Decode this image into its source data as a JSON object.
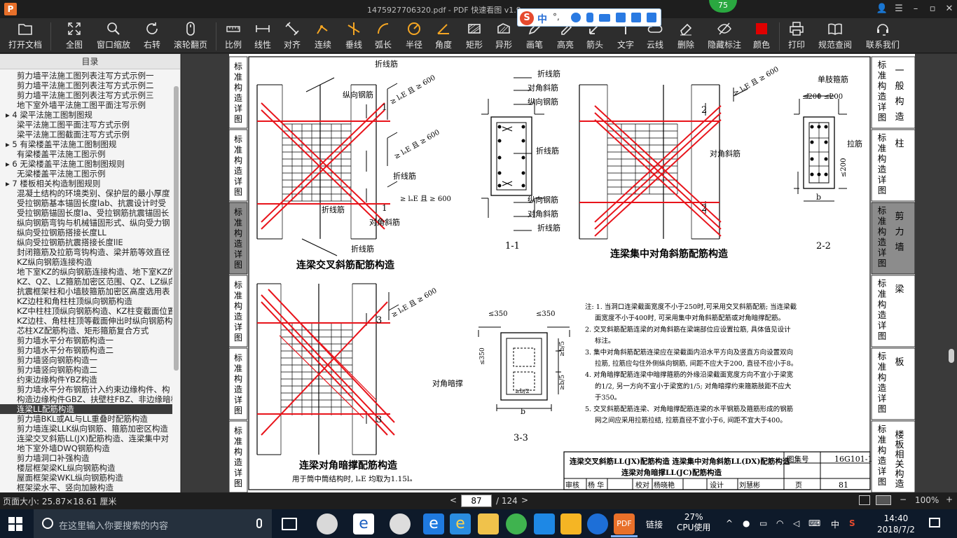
{
  "titlebar": {
    "title": "1475927706320.pdf - PDF 快速看图 v1.9",
    "logo": "P",
    "score": "75",
    "ime_zh": "中",
    "ime_symbols": "°,",
    "controls": [
      "user-icon",
      "menu-icon",
      "minimize-icon",
      "maximize-icon",
      "close-icon"
    ]
  },
  "toolbar": {
    "items": [
      {
        "label": "打开文档",
        "icon": "folder-icon"
      },
      {
        "label": "全图",
        "icon": "fit-icon"
      },
      {
        "label": "窗口缩放",
        "icon": "magnifier-icon"
      },
      {
        "label": "右转",
        "icon": "rotate-icon"
      },
      {
        "label": "滚轮翻页",
        "icon": "mouse-icon"
      },
      {
        "label": "比例",
        "icon": "ruler-icon"
      },
      {
        "label": "线性",
        "icon": "linear-icon"
      },
      {
        "label": "对齐",
        "icon": "align-icon"
      },
      {
        "label": "连续",
        "icon": "continuous-icon"
      },
      {
        "label": "垂线",
        "icon": "perpendicular-icon"
      },
      {
        "label": "弧长",
        "icon": "arc-icon"
      },
      {
        "label": "半径",
        "icon": "radius-icon"
      },
      {
        "label": "角度",
        "icon": "angle-icon"
      },
      {
        "label": "矩形",
        "icon": "rectangle-icon"
      },
      {
        "label": "异形",
        "icon": "polygon-icon"
      },
      {
        "label": "画笔",
        "icon": "pen-icon"
      },
      {
        "label": "高亮",
        "icon": "highlight-icon"
      },
      {
        "label": "箭头",
        "icon": "arrow-icon"
      },
      {
        "label": "文字",
        "icon": "text-icon"
      },
      {
        "label": "云线",
        "icon": "cloud-icon"
      },
      {
        "label": "删除",
        "icon": "eraser-icon"
      },
      {
        "label": "隐藏标注",
        "icon": "eye-icon"
      },
      {
        "label": "颜色",
        "icon": "color-icon"
      },
      {
        "label": "打印",
        "icon": "printer-icon"
      },
      {
        "label": "规范查阅",
        "icon": "book-icon"
      },
      {
        "label": "联系我们",
        "icon": "support-icon"
      }
    ],
    "accent_color": "#e00000"
  },
  "sidebar": {
    "header": "目录",
    "items": [
      {
        "text": "剪力墙平法施工图列表注写方式示例一",
        "level": 2
      },
      {
        "text": "剪力墙平法施工图列表注写方式示例二",
        "level": 2
      },
      {
        "text": "剪力墙平法施工图列表注写方式示例三",
        "level": 2
      },
      {
        "text": "地下室外墙平法施工图平面注写示例",
        "level": 2
      },
      {
        "text": "4 梁平法施工图制图规",
        "level": 1,
        "marker": "▸"
      },
      {
        "text": "梁平法施工图平面注写方式示例",
        "level": 2
      },
      {
        "text": "梁平法施工图截面注写方式示例",
        "level": 2
      },
      {
        "text": "5 有梁楼盖平法施工图制图规",
        "level": 1,
        "marker": "▸"
      },
      {
        "text": "有梁楼盖平法施工图示例",
        "level": 2
      },
      {
        "text": "6 无梁楼盖平法施工图制图规则",
        "level": 1,
        "marker": "▸"
      },
      {
        "text": "无梁楼盖平法施工图示例",
        "level": 2
      },
      {
        "text": "7 楼板相关构造制图规则",
        "level": 1,
        "marker": "▸"
      },
      {
        "text": "混凝土结构的环境类别、保护层的最小厚度",
        "level": 2
      },
      {
        "text": "受拉钢筋基本锚固长度lab、抗震设计时受",
        "level": 2
      },
      {
        "text": "受拉钢筋锚固长度la、受拉钢筋抗震锚固长",
        "level": 2
      },
      {
        "text": "纵向钢筋弯钩与机械锚固形式、纵向受力钢",
        "level": 2
      },
      {
        "text": "纵向受拉钢筋搭接长度LL",
        "level": 2
      },
      {
        "text": "纵向受拉钢筋抗震搭接长度llE",
        "level": 2
      },
      {
        "text": "封闭箍筋及拉筋弯钩构造、梁并筋等效直径",
        "level": 2
      },
      {
        "text": "KZ纵向钢筋连接构造",
        "level": 2
      },
      {
        "text": "地下室KZ的纵向钢筋连接构造、地下室KZ的",
        "level": 2
      },
      {
        "text": "KZ、QZ、LZ箍筋加密区范围、QZ、LZ纵向钢",
        "level": 2
      },
      {
        "text": "抗震框架柱和小墙肢箍筋加密区高度选用表",
        "level": 2
      },
      {
        "text": "KZ边柱和角柱柱顶纵向钢筋构造",
        "level": 2
      },
      {
        "text": "KZ中柱柱顶纵向钢筋构造、KZ柱变截面位置",
        "level": 2
      },
      {
        "text": "KZ边柱、角柱柱顶等截面伸出时纵向钢筋构",
        "level": 2
      },
      {
        "text": "芯柱XZ配筋构造、矩形箍筋复合方式",
        "level": 2
      },
      {
        "text": "剪力墙水平分布钢筋构造一",
        "level": 2
      },
      {
        "text": "剪力墙水平分布钢筋构造二",
        "level": 2
      },
      {
        "text": "剪力墙竖向钢筋构造一",
        "level": 2
      },
      {
        "text": "剪力墙竖向钢筋构造二",
        "level": 2
      },
      {
        "text": "约束边缘构件YBZ构造",
        "level": 2
      },
      {
        "text": "剪力墙水平分布钢筋计入约束边缘构件、构",
        "level": 2
      },
      {
        "text": "构造边缘构件GBZ、扶壁柱FBZ、非边缘暗柱",
        "level": 2
      },
      {
        "text": "连梁LL配筋构造",
        "level": 2,
        "selected": true
      },
      {
        "text": "剪力墙BKL或AL与LL重叠时配筋构造",
        "level": 2
      },
      {
        "text": "剪力墙连梁LLK纵向钢筋、箍筋加密区构造",
        "level": 2
      },
      {
        "text": "连梁交叉斜筋LL(JX)配筋构造、连梁集中对",
        "level": 2
      },
      {
        "text": "地下室外墙DWQ钢筋构造",
        "level": 2
      },
      {
        "text": "剪力墙洞口补强构造",
        "level": 2
      },
      {
        "text": "楼层框架梁KL纵向钢筋构造",
        "level": 2
      },
      {
        "text": "屋面框架梁WKL纵向钢筋构造",
        "level": 2
      },
      {
        "text": "框架梁水平、竖向加腋构造",
        "level": 2
      }
    ]
  },
  "drawing": {
    "labels": {
      "fold_bar": "折线筋",
      "long_bar": "纵向钢筋",
      "diag_bar": "对角斜筋",
      "single_stirrup": "单肢箍筋",
      "tie_bar": "拉筋",
      "dark_brace": "对角暗撑",
      "lae_600": "≥ lₐE 且 ≥ 600",
      "le200": "≤200",
      "b": "b",
      "sec1_1": "1-1",
      "sec2_2": "2-2",
      "sec3_3": "3-3",
      "cut1": "1",
      "cut2": "2",
      "cut3": "3",
      "le350": "≤350",
      "b5": "≥b/5",
      "b2": "≥b/2"
    },
    "titles": {
      "cross": "连梁交叉斜筋配筋构造",
      "concentrated": "连梁集中对角斜筋配筋构造",
      "brace": "连梁对角暗撑配筋构造",
      "brace_note": "用于筒中筒结构时, lₐE 均取为1.15lₐ"
    },
    "notes": [
      "注: 1. 当洞口连梁截面宽度不小于250时,可采用交叉斜筋配筋; 当连梁截",
      "面宽度不小于400时, 可采用集中对角斜筋配筋或对角暗撑配筋。",
      "2. 交叉斜筋配筋连梁的对角斜筋在梁端部位应设置拉筋, 具体值见设计",
      "标注。",
      "3. 集中对角斜筋配筋连梁应在梁截面内沿水平方向及竖直方向设置双向",
      "拉筋, 拉筋应勾住外侧纵向钢筋, 间距不应大于200, 直径不应小于8。",
      "4. 对角暗撑配筋连梁中暗撑箍筋的外缘沿梁截面宽度方向不宜小于梁宽",
      "的1/2, 另一方向不宜小于梁宽的1/5; 对角暗撑约束箍筋肢距不应大",
      "于350。",
      "5. 交叉斜筋配筋连梁、对角暗撑配筋连梁的水平钢筋及箍筋形成的钢筋",
      "网之间应采用拉筋拉结, 拉筋直径不宜小于6, 间距不宜大于400。"
    ],
    "title_block": {
      "line1": "连梁交叉斜筋LL(JX)配筋构造  连梁集中对角斜筋LL(DX)配筋构造",
      "line2": "连梁对角暗撑LL(JC)配筋构造",
      "atlas_label": "图集号",
      "atlas_no": "16G101-1",
      "review": "审核",
      "reviewer": "杨 华",
      "check": "校对",
      "checker": "杨晓艳",
      "design": "设计",
      "designer": "刘慧彬",
      "page_label": "页",
      "page_no": "81"
    },
    "side_tabs": [
      {
        "main": "标准构造详图",
        "sub": "一般构造"
      },
      {
        "main": "标准构造详图",
        "sub": "柱"
      },
      {
        "main": "标准构造详图",
        "sub": "剪力墙",
        "active": true
      },
      {
        "main": "标准构造详图",
        "sub": "梁"
      },
      {
        "main": "标准构造详图",
        "sub": "板"
      },
      {
        "main": "标准构造详图",
        "sub": "楼板相关构造"
      }
    ],
    "left_tabs": [
      "标准构造详图",
      "标准构造详图",
      "标准构造详图",
      "标准构造详图",
      "标准构造详图",
      "标准构造详图"
    ],
    "red_color": "#e8141b"
  },
  "statusbar": {
    "page_size": "页面大小: 25.87×18.61 厘米",
    "current_page": "87",
    "total_pages": "/ 124",
    "zoom": "100%",
    "prev": "<",
    "next": ">"
  },
  "taskbar": {
    "search_placeholder": "在这里输入你要搜索的内容",
    "cpu_value": "27%",
    "cpu_label": "CPU使用",
    "link_label": "链接",
    "time": "14:40",
    "date": "2018/7/2",
    "ime": "中"
  }
}
